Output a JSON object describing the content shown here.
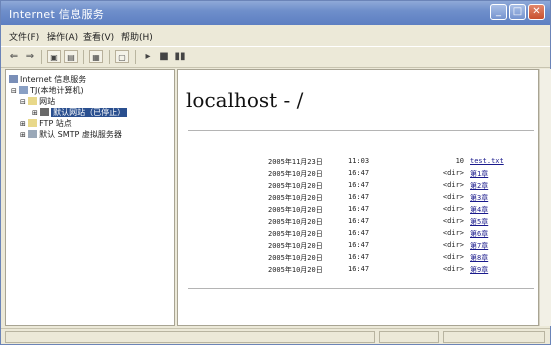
{
  "window": {
    "title": "Internet 信息服务"
  },
  "menu": [
    "文件(F)",
    "操作(A)",
    "查看(V)",
    "帮助(H)"
  ],
  "tree": [
    {
      "label": "Internet 信息服务",
      "icon": "computer-icon"
    },
    {
      "label": "TJ(本地计算机)",
      "icon": "server-icon"
    },
    {
      "label": "网站",
      "icon": "folder-icon"
    },
    {
      "label": "默认网站（已停止）",
      "icon": "site-icon"
    },
    {
      "label": "FTP 站点",
      "icon": "folder-icon"
    },
    {
      "label": "默认 SMTP 虚拟服务器",
      "icon": "smtp-icon"
    }
  ],
  "page": {
    "heading": "localhost - /",
    "rows": [
      {
        "date": "2005年11月23日",
        "time": "11:03",
        "type": "10",
        "name": "test.txt"
      },
      {
        "date": "2005年10月20日",
        "time": "16:47",
        "type": "<dir>",
        "name": "第1章"
      },
      {
        "date": "2005年10月20日",
        "time": "16:47",
        "type": "<dir>",
        "name": "第2章"
      },
      {
        "date": "2005年10月20日",
        "time": "16:47",
        "type": "<dir>",
        "name": "第3章"
      },
      {
        "date": "2005年10月20日",
        "time": "16:47",
        "type": "<dir>",
        "name": "第4章"
      },
      {
        "date": "2005年10月20日",
        "time": "16:47",
        "type": "<dir>",
        "name": "第5章"
      },
      {
        "date": "2005年10月20日",
        "time": "16:47",
        "type": "<dir>",
        "name": "第6章"
      },
      {
        "date": "2005年10月20日",
        "time": "16:47",
        "type": "<dir>",
        "name": "第7章"
      },
      {
        "date": "2005年10月20日",
        "time": "16:47",
        "type": "<dir>",
        "name": "第8章"
      },
      {
        "date": "2005年10月20日",
        "time": "16:47",
        "type": "<dir>",
        "name": "第9章"
      }
    ]
  },
  "colors": {
    "titlebar": "#6f8fcb",
    "link": "#1a1a8c",
    "selection": "#2a4f8f"
  }
}
